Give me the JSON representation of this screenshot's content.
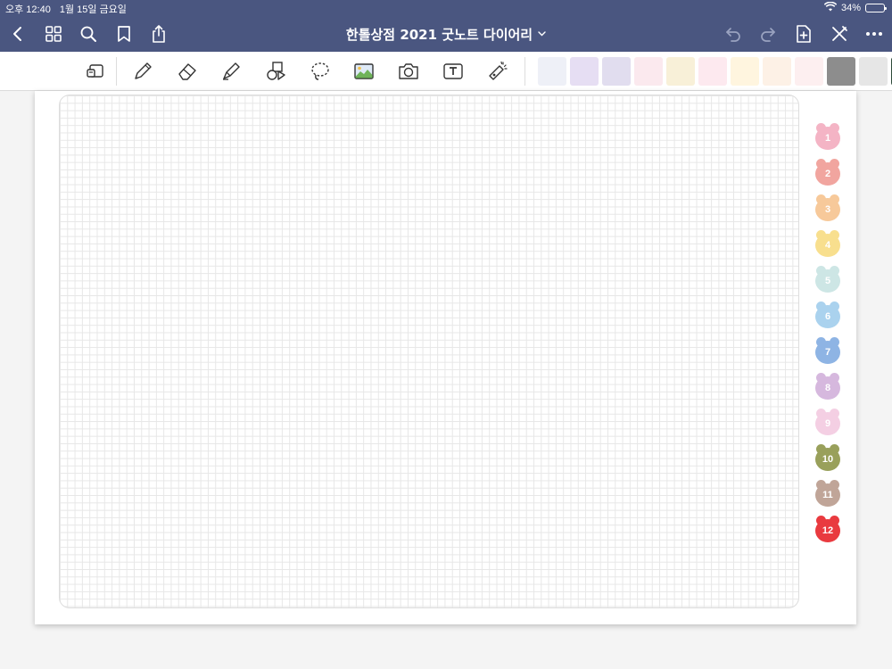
{
  "status_bar": {
    "time": "오후 12:40",
    "date": "1월 15일 금요일",
    "battery_text": "34%",
    "battery_level": 0.34
  },
  "nav": {
    "document_title": "한톨상점 2021 굿노트 다이어리",
    "icons": [
      "back-icon",
      "thumbnails-icon",
      "search-icon",
      "bookmark-icon",
      "share-icon",
      "undo-icon",
      "redo-icon",
      "add-page-icon",
      "close-icon",
      "more-icon"
    ]
  },
  "toolbar": {
    "tools": [
      "zoom-window-icon",
      "pen-icon",
      "eraser-icon",
      "highlighter-icon",
      "shapes-icon",
      "lasso-icon",
      "image-icon",
      "camera-icon",
      "text-icon",
      "laser-pointer-icon"
    ],
    "sticker_thumbs": [
      {
        "bg": "#eef0f7"
      },
      {
        "bg": "#e6def3"
      },
      {
        "bg": "#e1ddef"
      },
      {
        "bg": "#fbe9ee"
      },
      {
        "bg": "#f8f0d8"
      },
      {
        "bg": "#fde9ef"
      },
      {
        "bg": "#fff5df"
      },
      {
        "bg": "#fdf1e6"
      },
      {
        "bg": "#fdeff0"
      },
      {
        "bg": "#8d8d8d"
      },
      {
        "bg": "#e6e6e6"
      },
      {
        "bg": "#2e4a3a"
      }
    ]
  },
  "colors": {
    "header": "#4a5680",
    "page_background": "#ffffff",
    "grid_line": "#e7e7e7"
  },
  "month_tabs": [
    {
      "label": "1",
      "color": "#f4b4c5"
    },
    {
      "label": "2",
      "color": "#f1a59f"
    },
    {
      "label": "3",
      "color": "#f7c99a"
    },
    {
      "label": "4",
      "color": "#f8df8e"
    },
    {
      "label": "5",
      "color": "#cde6e5"
    },
    {
      "label": "6",
      "color": "#aad2ee"
    },
    {
      "label": "7",
      "color": "#8eb4e4"
    },
    {
      "label": "8",
      "color": "#d6b8de"
    },
    {
      "label": "9",
      "color": "#f4cfe3"
    },
    {
      "label": "10",
      "color": "#99a05b"
    },
    {
      "label": "11",
      "color": "#c0a598"
    },
    {
      "label": "12",
      "color": "#e93a3f"
    }
  ]
}
